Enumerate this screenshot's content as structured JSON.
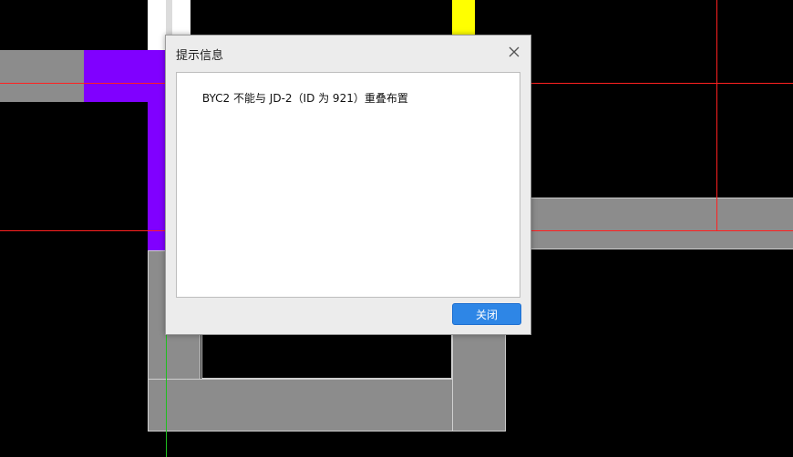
{
  "dialog": {
    "title": "提示信息",
    "message": "BYC2 不能与 JD-2（ID 为 921）重叠布置",
    "close_button_label": "关闭",
    "close_icon": "close-icon"
  },
  "colors": {
    "background": "#000000",
    "wall_gray": "#8c8c8c",
    "purple": "#8000ff",
    "yellow": "#ffff00",
    "axis_red": "#ff2020",
    "axis_green": "#1fbf1f",
    "button_blue": "#2e86e6"
  }
}
